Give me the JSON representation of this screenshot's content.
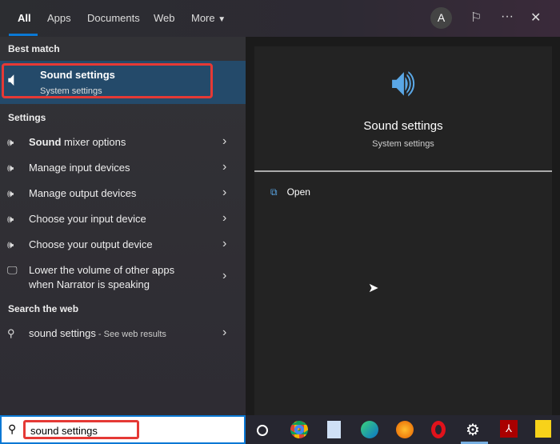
{
  "tabs": [
    "All",
    "Apps",
    "Documents",
    "Web",
    "More"
  ],
  "avatar": "A",
  "best_match": {
    "heading": "Best match",
    "title": "Sound settings",
    "subtitle": "System settings"
  },
  "settings": {
    "heading": "Settings",
    "items": [
      {
        "bold": "Sound",
        "rest": " mixer options"
      },
      {
        "bold": "",
        "rest": "Manage input devices"
      },
      {
        "bold": "",
        "rest": "Manage output devices"
      },
      {
        "bold": "",
        "rest": "Choose your input device"
      },
      {
        "bold": "",
        "rest": "Choose your output device"
      }
    ],
    "narrator_line1": "Lower the volume of other apps",
    "narrator_line2": "when Narrator is speaking"
  },
  "web": {
    "heading": "Search the web",
    "query": "sound settings",
    "suffix": " - See web results"
  },
  "preview": {
    "title": "Sound settings",
    "subtitle": "System settings",
    "open": "Open"
  },
  "search": {
    "value": "sound settings"
  },
  "colors": {
    "accent": "#0a78d4",
    "highlight": "#e53935",
    "selected": "#244a6a"
  }
}
